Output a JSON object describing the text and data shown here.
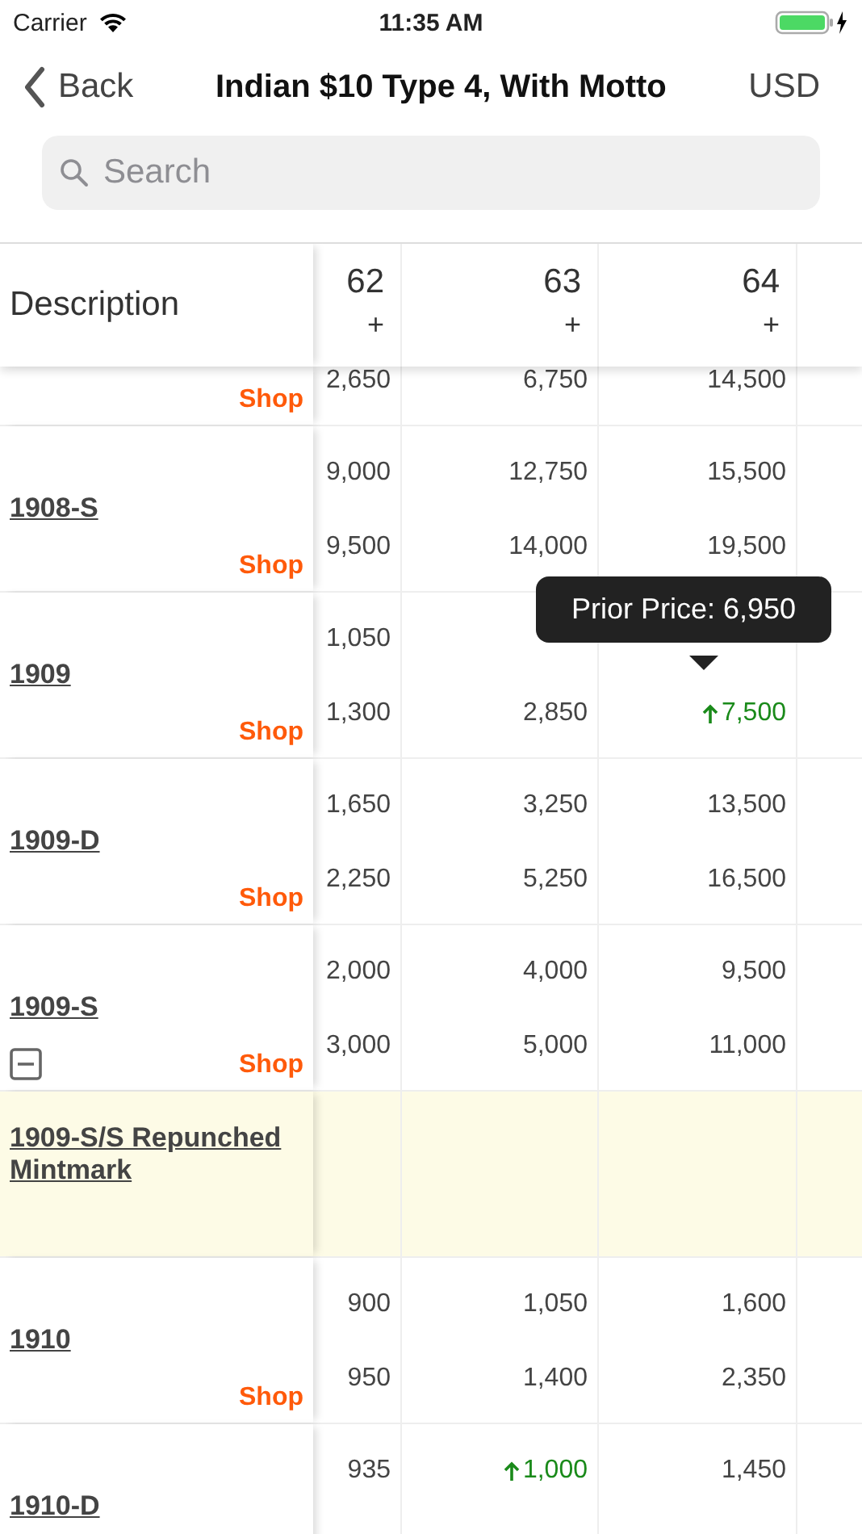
{
  "status_bar": {
    "carrier": "Carrier",
    "time": "11:35 AM"
  },
  "nav": {
    "back": "Back",
    "title": "Indian $10 Type 4, With Motto",
    "currency": "USD"
  },
  "search": {
    "placeholder": "Search"
  },
  "table": {
    "description_header": "Description",
    "columns": [
      {
        "grade": "62",
        "sign": "+"
      },
      {
        "grade": "63",
        "sign": "+"
      },
      {
        "grade": "64",
        "sign": "+"
      }
    ],
    "rows": [
      {
        "shop": "Shop",
        "bottom": [
          {
            "text": "2,650",
            "rising": false
          },
          {
            "text": "6,750",
            "rising": false
          },
          {
            "text": "14,500",
            "rising": false
          }
        ]
      },
      {
        "name": "1908-S",
        "shop": "Shop",
        "top": [
          {
            "text": "9,000",
            "rising": false
          },
          {
            "text": "12,750",
            "rising": false
          },
          {
            "text": "15,500",
            "rising": false
          }
        ],
        "bottom": [
          {
            "text": "9,500",
            "rising": false
          },
          {
            "text": "14,000",
            "rising": false
          },
          {
            "text": "19,500",
            "rising": false
          }
        ]
      },
      {
        "name": "1909",
        "shop": "Shop",
        "top": [
          {
            "text": "1,050",
            "rising": false
          }
        ],
        "bottom": [
          {
            "text": "1,300",
            "rising": false
          },
          {
            "text": "2,850",
            "rising": false
          },
          {
            "text": "7,500",
            "rising": true
          }
        ],
        "tooltip": "Prior Price: 6,950"
      },
      {
        "name": "1909-D",
        "shop": "Shop",
        "top": [
          {
            "text": "1,650",
            "rising": false
          },
          {
            "text": "3,250",
            "rising": false
          },
          {
            "text": "13,500",
            "rising": false
          }
        ],
        "bottom": [
          {
            "text": "2,250",
            "rising": false
          },
          {
            "text": "5,250",
            "rising": false
          },
          {
            "text": "16,500",
            "rising": false
          }
        ]
      },
      {
        "name": "1909-S",
        "shop": "Shop",
        "expanded": true,
        "top": [
          {
            "text": "2,000",
            "rising": false
          },
          {
            "text": "4,000",
            "rising": false
          },
          {
            "text": "9,500",
            "rising": false
          }
        ],
        "bottom": [
          {
            "text": "3,000",
            "rising": false
          },
          {
            "text": "5,000",
            "rising": false
          },
          {
            "text": "11,000",
            "rising": false
          }
        ]
      },
      {
        "name": "1909-S/S  Repunched Mintmark",
        "highlighted": true
      },
      {
        "name": "1910",
        "shop": "Shop",
        "top": [
          {
            "text": "900",
            "rising": false
          },
          {
            "text": "1,050",
            "rising": false
          },
          {
            "text": "1,600",
            "rising": false
          }
        ],
        "bottom": [
          {
            "text": "950",
            "rising": false
          },
          {
            "text": "1,400",
            "rising": false
          },
          {
            "text": "2,350",
            "rising": false
          }
        ]
      },
      {
        "name": "1910-D",
        "top": [
          {
            "text": "935",
            "rising": false
          },
          {
            "text": "1,000",
            "rising": true
          },
          {
            "text": "1,450",
            "rising": false
          }
        ]
      }
    ]
  }
}
